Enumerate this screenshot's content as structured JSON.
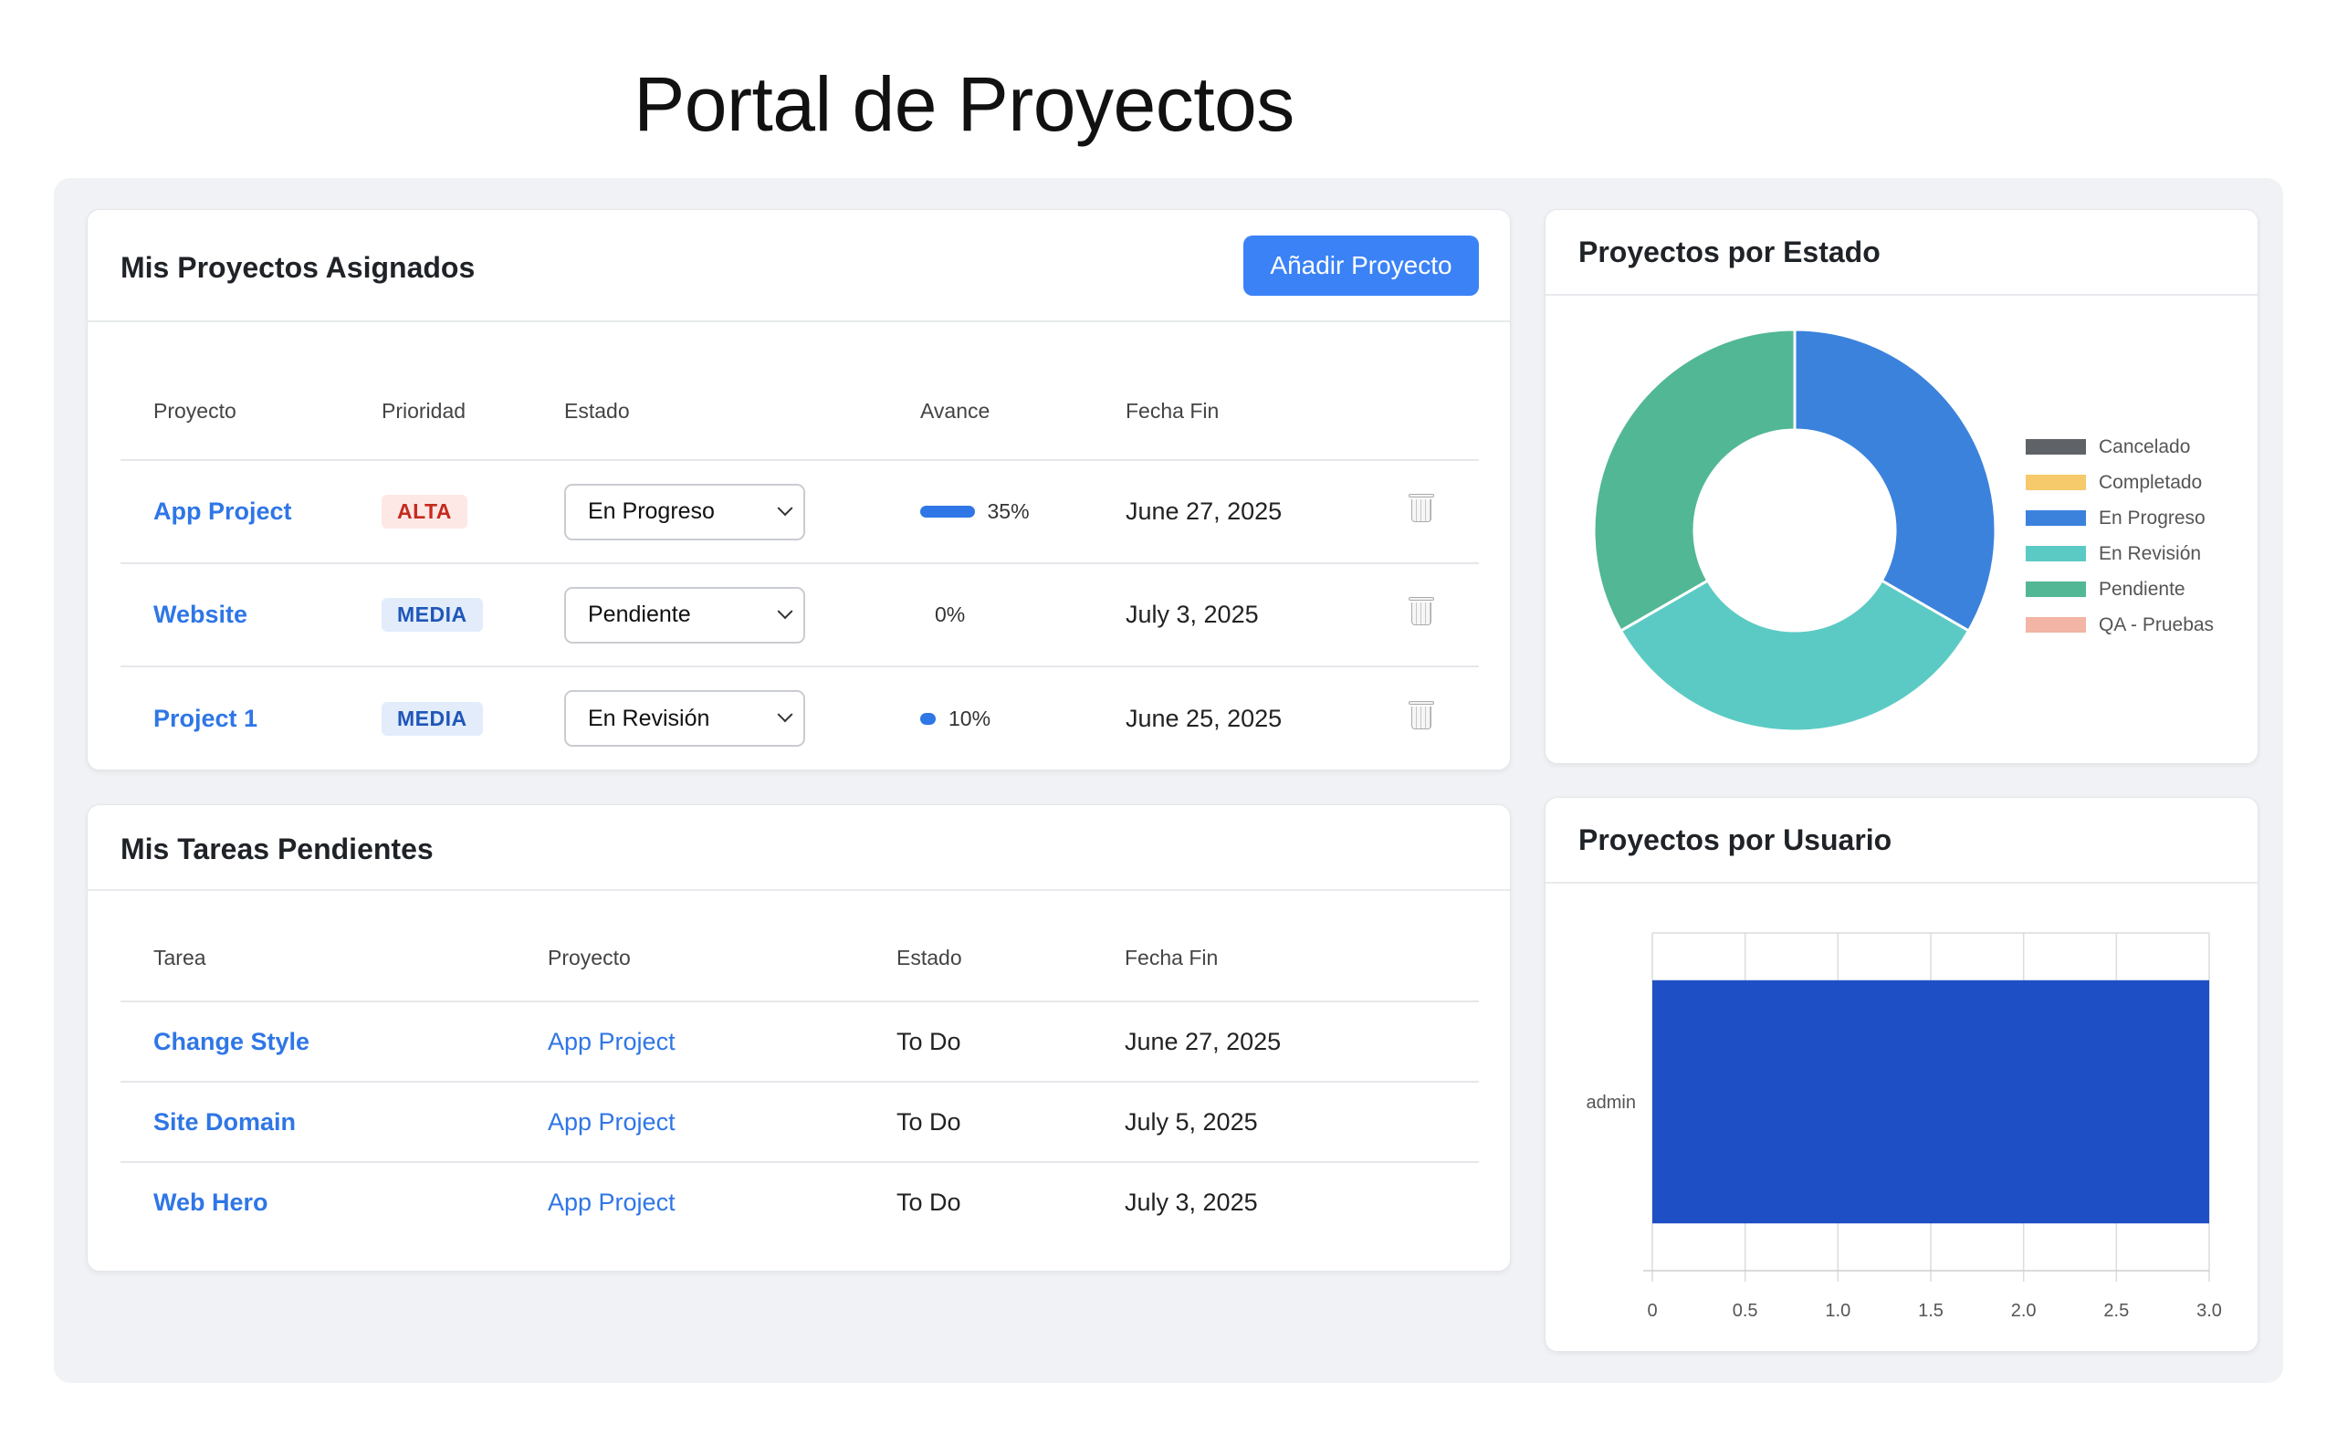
{
  "page": {
    "title": "Portal de Proyectos"
  },
  "projects": {
    "title": "Mis Proyectos Asignados",
    "add_button": "Añadir Proyecto",
    "columns": [
      "Proyecto",
      "Prioridad",
      "Estado",
      "Avance",
      "Fecha Fin"
    ],
    "rows": [
      {
        "name": "App Project",
        "priority": "ALTA",
        "priority_level": "high",
        "status": "En Progreso",
        "progress_label": "35%",
        "progress": 35,
        "end_date": "June 27, 2025"
      },
      {
        "name": "Website",
        "priority": "MEDIA",
        "priority_level": "medium",
        "status": "Pendiente",
        "progress_label": "0%",
        "progress": 0,
        "end_date": "July 3, 2025"
      },
      {
        "name": "Project 1",
        "priority": "MEDIA",
        "priority_level": "medium",
        "status": "En Revisión",
        "progress_label": "10%",
        "progress": 10,
        "end_date": "June 25, 2025"
      }
    ],
    "delete_icon": "trash-icon"
  },
  "tasks": {
    "title": "Mis Tareas Pendientes",
    "columns": [
      "Tarea",
      "Proyecto",
      "Estado",
      "Fecha Fin"
    ],
    "rows": [
      {
        "task": "Change Style",
        "project": "App Project",
        "status": "To Do",
        "end_date": "June 27, 2025"
      },
      {
        "task": "Site Domain",
        "project": "App Project",
        "status": "To Do",
        "end_date": "July 5, 2025"
      },
      {
        "task": "Web Hero",
        "project": "App Project",
        "status": "To Do",
        "end_date": "July 3, 2025"
      }
    ]
  },
  "status_chart": {
    "title": "Proyectos por Estado",
    "chart_data": {
      "type": "pie",
      "style": "doughnut",
      "legend_position": "right",
      "labels": [
        "Cancelado",
        "Completado",
        "En Progreso",
        "En Revisión",
        "Pendiente",
        "QA - Pruebas"
      ],
      "values": [
        0,
        0,
        1,
        1,
        1,
        0
      ],
      "colors": [
        "#5f6368",
        "#f6c96b",
        "#3b82dc",
        "#5ccac4",
        "#52b794",
        "#f2b5a6"
      ]
    }
  },
  "user_chart": {
    "title": "Proyectos por Usuario",
    "chart_data": {
      "type": "bar",
      "orientation": "horizontal",
      "categories": [
        "admin"
      ],
      "values": [
        3
      ],
      "xlim": [
        0,
        3
      ],
      "xticks": [
        "0",
        "0.5",
        "1.0",
        "1.5",
        "2.0",
        "2.5",
        "3.0"
      ],
      "grid": true,
      "color": "#1f4fc5"
    }
  }
}
